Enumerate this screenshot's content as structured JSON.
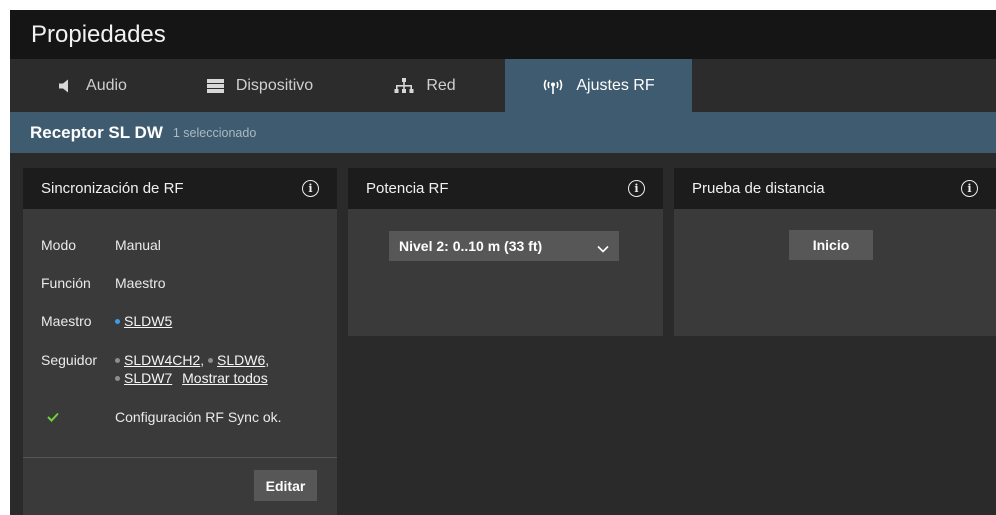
{
  "window": {
    "title": "Propiedades"
  },
  "tabs": [
    {
      "label": "Audio",
      "icon": "speaker-icon"
    },
    {
      "label": "Dispositivo",
      "icon": "device-icon"
    },
    {
      "label": "Red",
      "icon": "network-icon"
    },
    {
      "label": "Ajustes RF",
      "icon": "antenna-icon",
      "active": true
    }
  ],
  "context": {
    "device_name": "Receptor SL DW",
    "selection": "1 seleccionado"
  },
  "rf_sync": {
    "title": "Sincronización de RF",
    "mode_label": "Modo",
    "mode_value": "Manual",
    "function_label": "Función",
    "function_value": "Maestro",
    "master_label": "Maestro",
    "master_value": "SLDW5",
    "follower_label": "Seguidor",
    "followers": [
      "SLDW4CH2",
      "SLDW6",
      "SLDW7"
    ],
    "show_all": "Mostrar todos",
    "status": "Configuración RF Sync ok.",
    "edit_button": "Editar"
  },
  "rf_power": {
    "title": "Potencia RF",
    "selected": "Nivel 2: 0..10 m (33 ft)"
  },
  "range_test": {
    "title": "Prueba de distancia",
    "start_button": "Inicio"
  },
  "colors": {
    "accent": "#3f5b6f",
    "master_dot": "#3d9be9",
    "follower_dot": "#8e8e8e",
    "ok_check": "#6fd13d"
  }
}
